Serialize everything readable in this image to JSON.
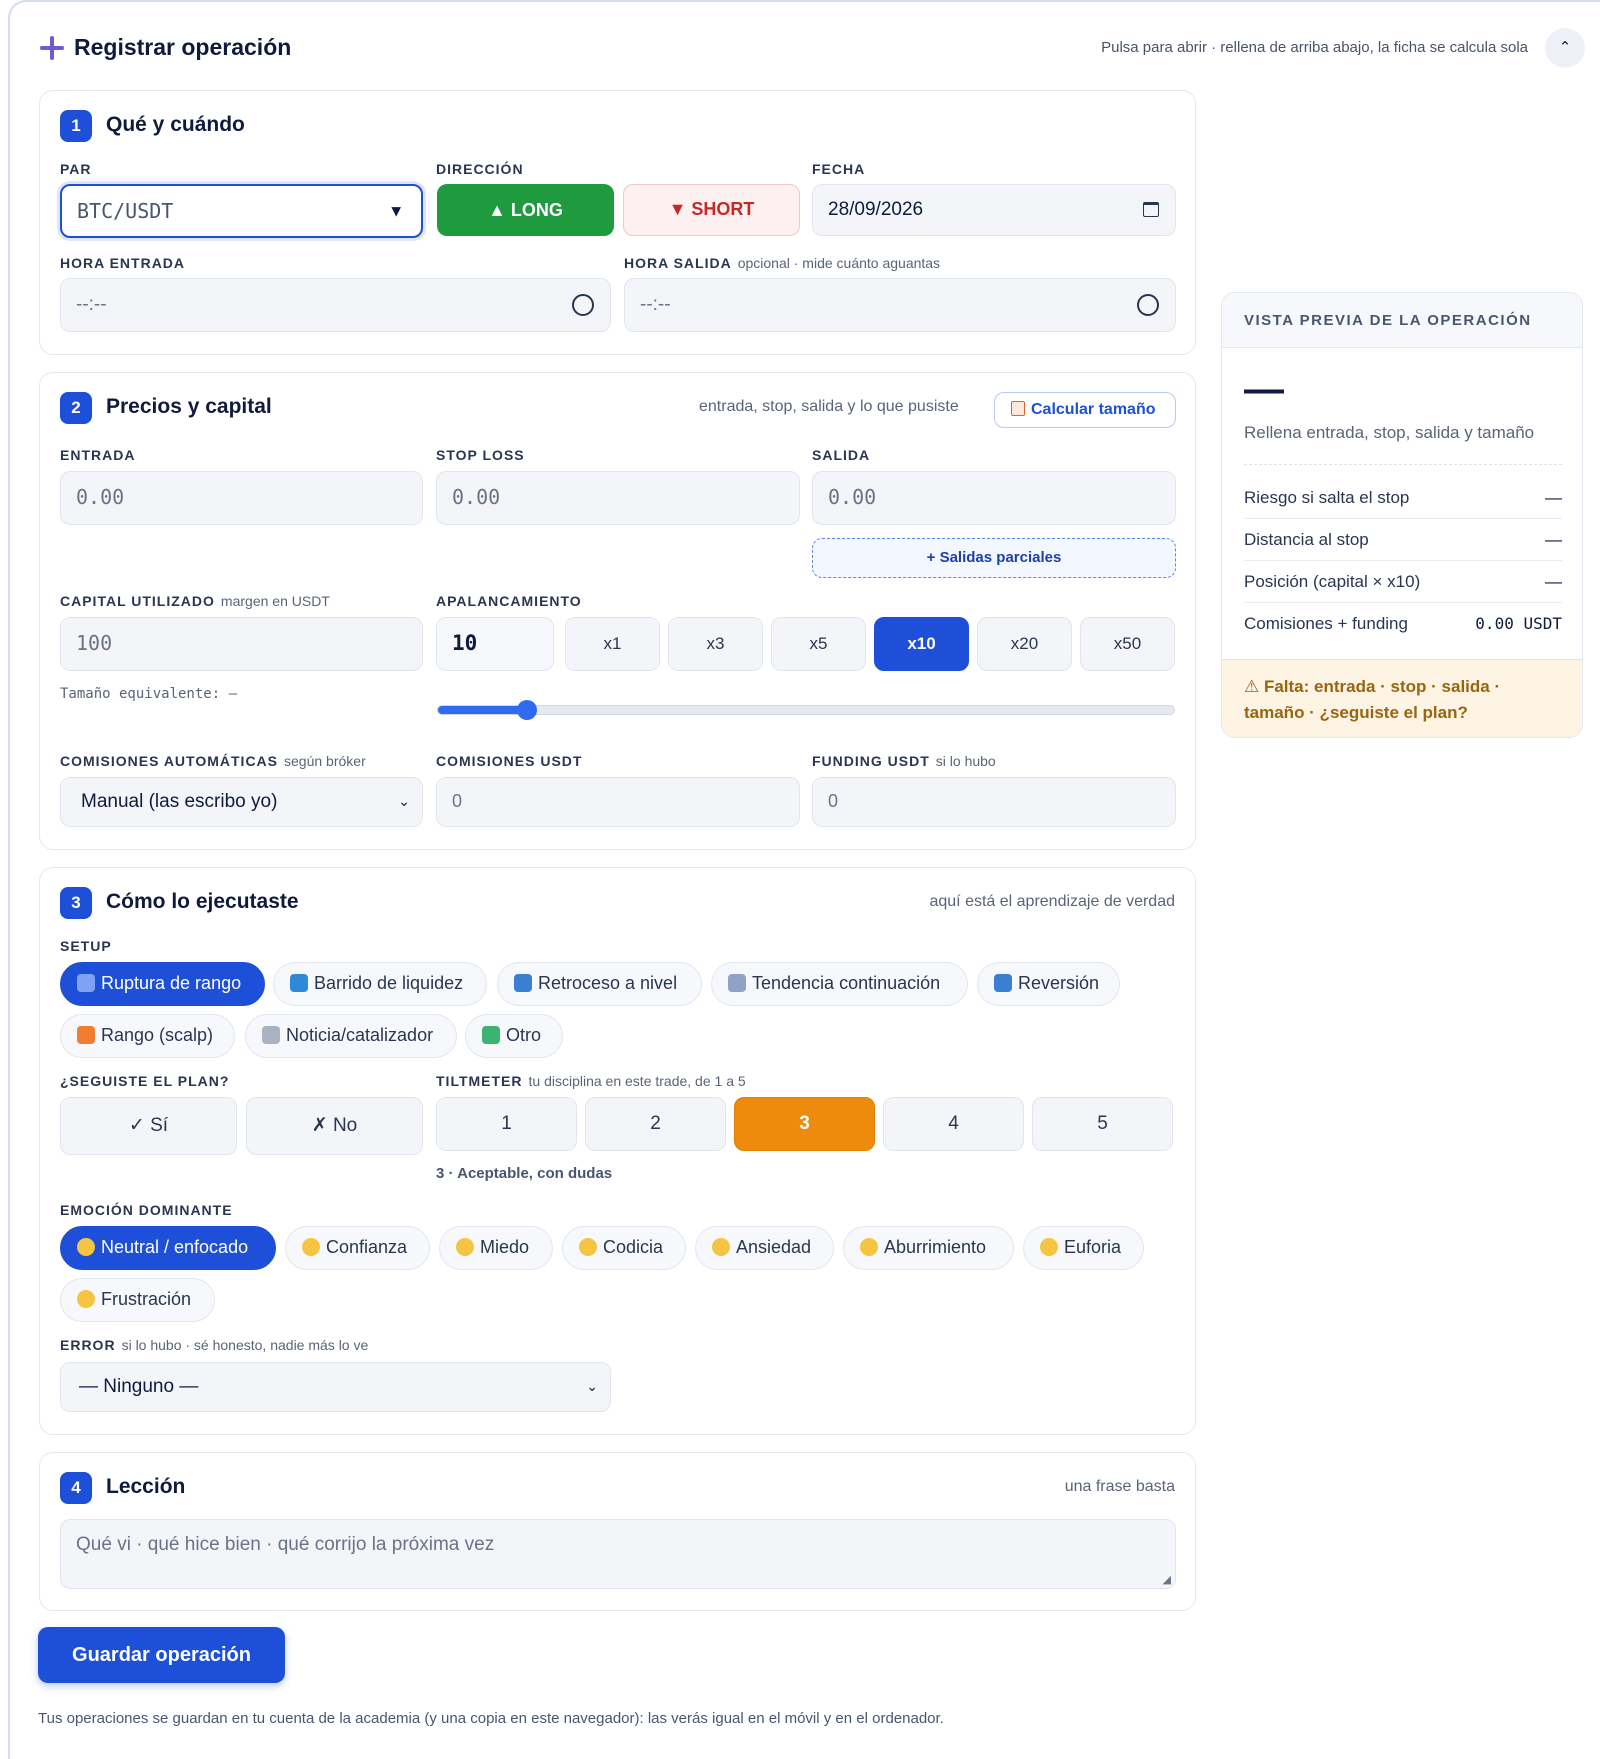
{
  "header": {
    "title": "Registrar operación",
    "hint": "Pulsa para abrir · rellena de arriba abajo, la ficha se calcula sola",
    "collapse": "⌃"
  },
  "s1": {
    "num": "1",
    "title": "Qué y cuándo",
    "par_label": "PAR",
    "par_value": "BTC/USDT",
    "dir_label": "DIRECCIÓN",
    "long": "▲ LONG",
    "short": "▼ SHORT",
    "fecha_label": "FECHA",
    "fecha_value": "28/09/2026",
    "hora_entrada_label": "HORA ENTRADA",
    "hora_entrada_value": "--:--",
    "hora_salida_label": "HORA SALIDA",
    "hora_salida_sub": "opcional · mide cuánto aguantas",
    "hora_salida_value": "--:--"
  },
  "s2": {
    "num": "2",
    "title": "Precios y capital",
    "hint": "entrada, stop, salida y lo que pusiste",
    "calc_button": "Calcular tamaño",
    "entrada_label": "ENTRADA",
    "entrada_ph": "0.00",
    "stop_label": "STOP LOSS",
    "stop_ph": "0.00",
    "salida_label": "SALIDA",
    "salida_ph": "0.00",
    "parciales": "+ Salidas parciales",
    "capital_label": "CAPITAL UTILIZADO",
    "capital_sub": "margen en USDT",
    "capital_ph": "100",
    "tamano_equiv": "Tamaño equivalente: —",
    "apal_label": "APALANCAMIENTO",
    "apal_value": "10",
    "lev_options": [
      "x1",
      "x3",
      "x5",
      "x10",
      "x20",
      "x50"
    ],
    "lev_selected": "x10",
    "lev_slider_fraction": 0.12,
    "com_auto_label": "COMISIONES AUTOMÁTICAS",
    "com_auto_sub": "según bróker",
    "com_auto_value": "Manual (las escribo yo)",
    "com_usdt_label": "COMISIONES USDT",
    "com_usdt_ph": "0",
    "funding_label": "FUNDING USDT",
    "funding_sub": "si lo hubo",
    "funding_ph": "0"
  },
  "s3": {
    "num": "3",
    "title": "Cómo lo ejecutaste",
    "hint": "aquí está el aprendizaje de verdad",
    "setup_label": "SETUP",
    "setups": [
      "Ruptura de rango",
      "Barrido de liquidez",
      "Retroceso a nivel",
      "Tendencia continuación",
      "Reversión",
      "Rango (scalp)",
      "Noticia/catalizador",
      "Otro"
    ],
    "plan_label": "¿SEGUISTE EL PLAN?",
    "plan_yes": "✓ Sí",
    "plan_no": "✗ No",
    "tilt_label": "TILTMETER",
    "tilt_sub": "tu disciplina en este trade, de 1 a 5",
    "tilt_options": [
      "1",
      "2",
      "3",
      "4",
      "5"
    ],
    "tilt_selected": "3",
    "tilt_caption": "3 · Aceptable, con dudas",
    "emo_label": "EMOCIÓN DOMINANTE",
    "emotions": [
      "Neutral / enfocado",
      "Confianza",
      "Miedo",
      "Codicia",
      "Ansiedad",
      "Aburrimiento",
      "Euforia",
      "Frustración"
    ],
    "error_label": "ERROR",
    "error_sub": "si lo hubo · sé honesto, nadie más lo ve",
    "error_value": "— Ninguno —"
  },
  "s4": {
    "num": "4",
    "title": "Lección",
    "hint": "una frase basta",
    "ph": "Qué vi · qué hice bien · qué corrijo la próxima vez"
  },
  "save_button": "Guardar operación",
  "footer": "Tus operaciones se guardan en tu cuenta de la academia (y una copia en este navegador): las verás igual en el móvil y en el ordenador.",
  "preview": {
    "title": "VISTA PREVIA DE LA OPERACIÓN",
    "big": "—",
    "hint": "Rellena entrada, stop, salida y tamaño",
    "rows": [
      {
        "label": "Riesgo si salta el stop",
        "value": "—"
      },
      {
        "label": "Distancia al stop",
        "value": "—"
      },
      {
        "label": "Posición (capital × x10)",
        "value": "—"
      },
      {
        "label": "Comisiones + funding",
        "value": "0.00 USDT"
      }
    ],
    "warning": "⚠ Falta: entrada · stop · salida · tamaño · ¿seguiste el plan?"
  },
  "colors": {
    "accent": "#1d4fd8",
    "long": "#1f9a3f",
    "short": "#c62828",
    "tilt": "#ee8a0c",
    "warn": "#9a6410"
  }
}
